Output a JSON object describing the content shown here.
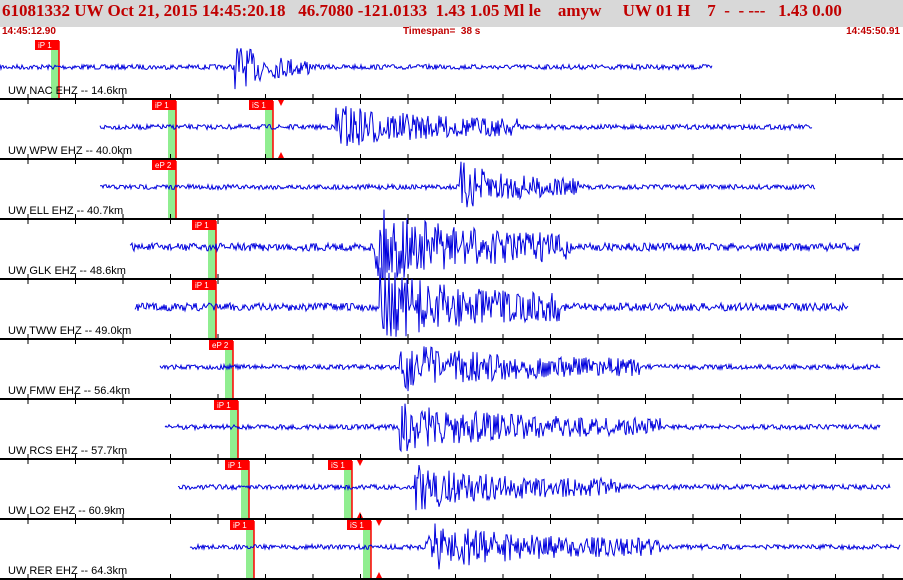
{
  "header": {
    "title": "61081332 UW Oct 21, 2015 14:45:20.18   46.7080 -121.0133  1.43 1.05 Ml le    amyw     UW 01 H    7  -  - ---   1.43 0.00",
    "start_time": "14:45:12.90",
    "timespan": "Timespan=  38 s",
    "end_time": "14:45:50.91",
    "colors": {
      "header_bg": "#d8d8d8",
      "header_text": "#c00000",
      "trace": "#0000dd",
      "pick": "#ff0000",
      "pick_window": "#90ee90",
      "separator": "#000000"
    }
  },
  "channels": [
    {
      "label": "UW NAC EHZ -- 14.6km",
      "amplitude": "medium",
      "picks": [
        {
          "label": "iP 1",
          "time": "14:45:15.4"
        }
      ]
    },
    {
      "label": "UW WPW EHZ -- 40.0km",
      "amplitude": "medium",
      "picks": [
        {
          "label": "iP 1",
          "time": "14:45:20.3"
        },
        {
          "label": "iS 1",
          "time": "14:45:24.4"
        }
      ]
    },
    {
      "label": "UW ELL EHZ -- 40.7km",
      "amplitude": "medium",
      "picks": [
        {
          "label": "eP 2",
          "time": "14:45:20.3"
        }
      ]
    },
    {
      "label": "UW GLK EHZ -- 48.6km",
      "amplitude": "high",
      "picks": [
        {
          "label": "iP 1",
          "time": "14:45:22.0"
        }
      ]
    },
    {
      "label": "UW TWW EHZ -- 49.0km",
      "amplitude": "high",
      "picks": [
        {
          "label": "iP 1",
          "time": "14:45:22.0"
        }
      ]
    },
    {
      "label": "UW FMW EHZ -- 56.4km",
      "amplitude": "medium",
      "picks": [
        {
          "label": "eP 2",
          "time": "14:45:22.7"
        }
      ]
    },
    {
      "label": "UW RCS EHZ -- 57.7km",
      "amplitude": "medium",
      "picks": [
        {
          "label": "iP 1",
          "time": "14:45:22.9"
        }
      ]
    },
    {
      "label": "UW LO2 EHZ -- 60.9km",
      "amplitude": "medium",
      "picks": [
        {
          "label": "iP 1",
          "time": "14:45:23.4"
        },
        {
          "label": "iS 1",
          "time": "14:45:27.7"
        }
      ]
    },
    {
      "label": "UW RER EHZ -- 64.3km",
      "amplitude": "medium",
      "picks": [
        {
          "label": "iP 1",
          "time": "14:45:23.6"
        },
        {
          "label": "iS 1",
          "time": "14:45:28.5"
        }
      ]
    }
  ]
}
